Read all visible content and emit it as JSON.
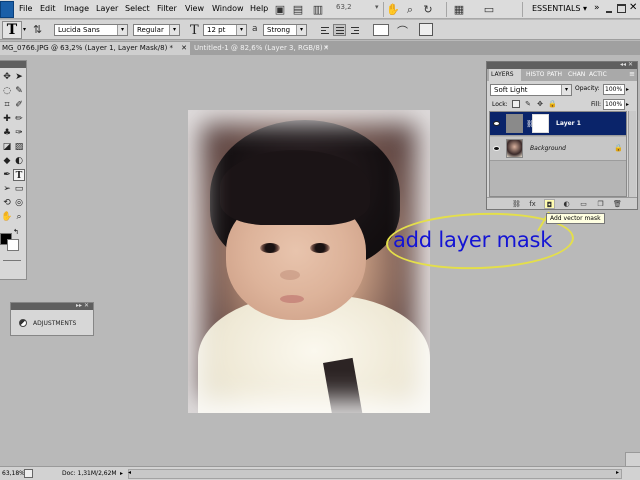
{
  "menu": {
    "items": [
      "File",
      "Edit",
      "Image",
      "Layer",
      "Select",
      "Filter",
      "View",
      "Window",
      "Help"
    ],
    "zoom": "63,2",
    "workspace": "ESSENTIALS"
  },
  "options": {
    "font_family": "Lucida Sans",
    "font_style": "Regular",
    "font_size": "12 pt",
    "aa_label": "a",
    "antialias": "Strong"
  },
  "tabs": [
    {
      "label": "MG_0766.JPG @ 63,2% (Layer 1, Layer Mask/8) *"
    },
    {
      "label": "Untitled-1 @ 82,6% (Layer 3, RGB/8) *"
    }
  ],
  "annotation": {
    "text": "add layer mask",
    "ellipse_color": "#e4df4a",
    "text_color": "#1414d4"
  },
  "adjustments": {
    "label": "ADJUSTMENTS"
  },
  "layers_panel": {
    "tabs": [
      "LAYERS",
      "HISTO",
      "PATH",
      "CHAN",
      "ACTIC"
    ],
    "blend_mode": "Soft Light",
    "opacity_label": "Opacity:",
    "opacity": "100%",
    "lock_label": "Lock:",
    "fill_label": "Fill:",
    "fill": "100%",
    "layers": [
      {
        "name": "Layer 1",
        "selected": true
      },
      {
        "name": "Background",
        "selected": false
      }
    ],
    "tooltip": "Add vector mask"
  },
  "status": {
    "zoom": "63,18%",
    "doc_info": "Doc: 1,31M/2,62M"
  },
  "colors": {
    "selected_layer": "#0a246a",
    "panel_header": "#5f5f5f",
    "canvas_bg": "#b9b9b9"
  }
}
